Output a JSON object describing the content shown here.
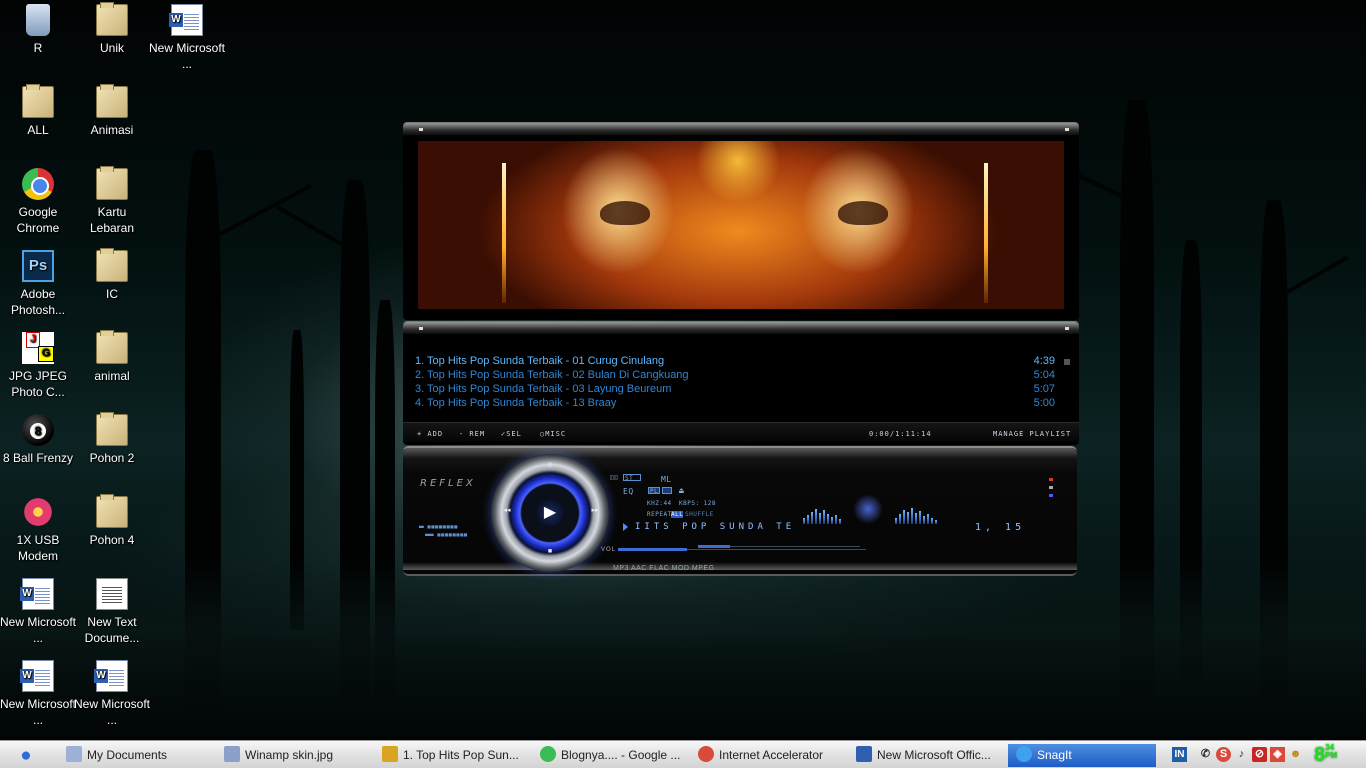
{
  "desktop": {
    "icons": [
      {
        "label": "R",
        "icon": "recycle-bin-icon"
      },
      {
        "label": "Unik",
        "icon": "folder-icon"
      },
      {
        "label": "New Microsoft ...",
        "icon": "word-document-icon"
      },
      {
        "label": "ALL",
        "icon": "folder-icon"
      },
      {
        "label": "Animasi",
        "icon": "folder-icon"
      },
      {
        "label": "Google Chrome",
        "icon": "chrome-icon"
      },
      {
        "label": "Kartu Lebaran",
        "icon": "folder-icon"
      },
      {
        "label": "Adobe Photosh...",
        "icon": "photoshop-icon"
      },
      {
        "label": "IC",
        "icon": "folder-icon"
      },
      {
        "label": "JPG JPEG Photo C...",
        "icon": "jpg-converter-icon"
      },
      {
        "label": "animal",
        "icon": "folder-icon"
      },
      {
        "label": "8 Ball Frenzy",
        "icon": "eight-ball-icon"
      },
      {
        "label": "Pohon 2",
        "icon": "folder-icon"
      },
      {
        "label": "1X USB Modem",
        "icon": "flower-modem-icon"
      },
      {
        "label": "Pohon 4",
        "icon": "folder-icon"
      },
      {
        "label": "New Microsoft ...",
        "icon": "word-document-icon"
      },
      {
        "label": "New Text Docume...",
        "icon": "text-document-icon"
      },
      {
        "label": "New Microsoft ...",
        "icon": "word-document-icon"
      },
      {
        "label": "New Microsoft ...",
        "icon": "word-document-icon"
      }
    ]
  },
  "winamp": {
    "playlist": [
      {
        "title": "1. Top Hits Pop Sunda Terbaik - 01 Curug Cinulang",
        "duration": "4:39"
      },
      {
        "title": "2. Top Hits Pop Sunda Terbaik - 02 Bulan Di Cangkuang",
        "duration": "5:04"
      },
      {
        "title": "3. Top Hits Pop Sunda Terbaik - 03 Layung Beureum",
        "duration": "5:07"
      },
      {
        "title": "4. Top Hits Pop Sunda Terbaik - 13 Braay",
        "duration": "5:00"
      }
    ],
    "playlist_bar": {
      "add": "+ ADD",
      "rem": "- REM",
      "sel": "SEL",
      "misc": "MISC",
      "total": "0:00/1:11:14",
      "manage": "MANAGE PLAYLIST"
    },
    "main": {
      "logo": "REFLEX",
      "ticker": "IITS POP SUNDA TE",
      "timer": "1, 15",
      "kbps_text": "KHZ:44",
      "kbps_label": "KBPS: 128",
      "repeat": "REPEAT",
      "repeat_all": "ALL",
      "shuffle": "SHUFFLE",
      "st": "ST",
      "ml": "ML",
      "eq": "EQ",
      "pl_label": "PL",
      "vol_label": "VOL",
      "formats": "MP3  AAC  FLAC  MOD  MPEG",
      "volume_level": 0.28,
      "seek_level": 0.2
    },
    "accent_color": "#3a6ed0"
  },
  "taskbar": {
    "start_icon": "apple-start-icon",
    "buttons": [
      {
        "label": "My Documents",
        "icon": "folder-icon",
        "color": "#9db0d6"
      },
      {
        "label": "Winamp skin.jpg",
        "icon": "image-icon",
        "color": "#8aa0c8"
      },
      {
        "label": "1. Top Hits Pop Sun...",
        "icon": "winamp-icon",
        "color": "#d9a521"
      },
      {
        "label": "Blognya.... - Google ...",
        "icon": "chrome-icon",
        "color": "#3cba54"
      },
      {
        "label": "Internet Accelerator",
        "icon": "accelerator-icon",
        "color": "#d84a3a"
      },
      {
        "label": "New Microsoft Offic...",
        "icon": "word-icon",
        "color": "#2f5fb0"
      },
      {
        "label": "SnagIt",
        "icon": "snagit-icon",
        "color": "#3ea1f0",
        "active": true
      }
    ],
    "clock": {
      "time": "8",
      "minutes": "34",
      "meridiem": "PM"
    },
    "tray_icons": [
      "in-icon",
      "phone-icon",
      "accelerator-tray-icon",
      "volume-icon",
      "antivirus-icon",
      "security-icon",
      "users-icon"
    ]
  }
}
